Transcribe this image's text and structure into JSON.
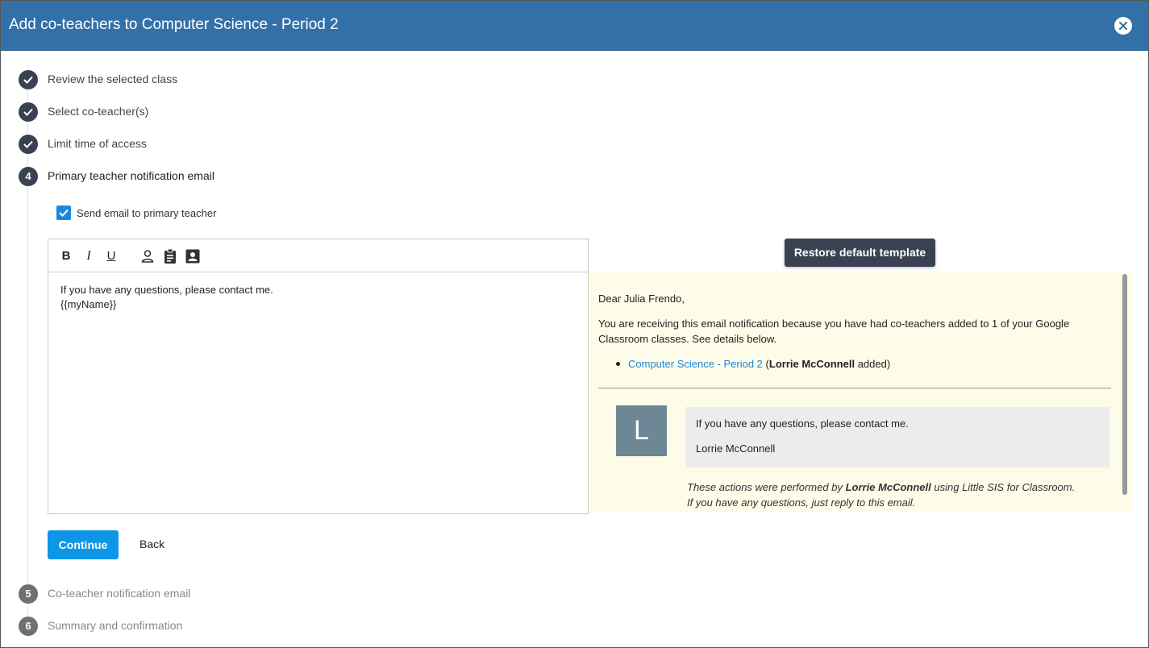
{
  "dialog": {
    "title": "Add co-teachers to Computer Science - Period 2"
  },
  "steps": [
    {
      "number": "1",
      "label": "Review the selected class",
      "status": "done"
    },
    {
      "number": "2",
      "label": "Select co-teacher(s)",
      "status": "done"
    },
    {
      "number": "3",
      "label": "Limit time of access",
      "status": "done"
    },
    {
      "number": "4",
      "label": "Primary teacher notification email",
      "status": "active"
    },
    {
      "number": "5",
      "label": "Co-teacher notification email",
      "status": "pending"
    },
    {
      "number": "6",
      "label": "Summary and confirmation",
      "status": "pending"
    }
  ],
  "send_email": {
    "label": "Send email to primary teacher",
    "checked": true
  },
  "editor": {
    "toolbar": {
      "bold": "B",
      "italic": "I",
      "underline": "U",
      "icons": [
        "person-icon",
        "clipboard-icon",
        "contact-card-icon"
      ]
    },
    "lines": [
      "If you have any questions, please contact me.",
      "{{myName}}"
    ]
  },
  "restore_button": "Restore default template",
  "preview": {
    "greeting": "Dear Julia Frendo,",
    "intro": "You are receiving this email notification because you have had co-teachers added to 1 of your Google Classroom classes. See details below.",
    "class_link": "Computer Science - Period 2",
    "open_paren": "(",
    "coteacher_name": "Lorrie McConnell",
    "added_suffix": "added)",
    "avatar_letter": "L",
    "message_line": "If you have any questions, please contact me.",
    "signature": "Lorrie McConnell",
    "footer_prefix": "These actions were performed by",
    "footer_name": "Lorrie McConnell",
    "footer_suffix": "using Little SIS for Classroom.",
    "footer_line2": "If you have any questions, just reply to this email."
  },
  "actions": {
    "continue": "Continue",
    "back": "Back"
  },
  "colors": {
    "header": "#3470a8",
    "step_done": "#3a4252",
    "accent": "#0d96e6",
    "preview_bg": "#fcfce8"
  }
}
